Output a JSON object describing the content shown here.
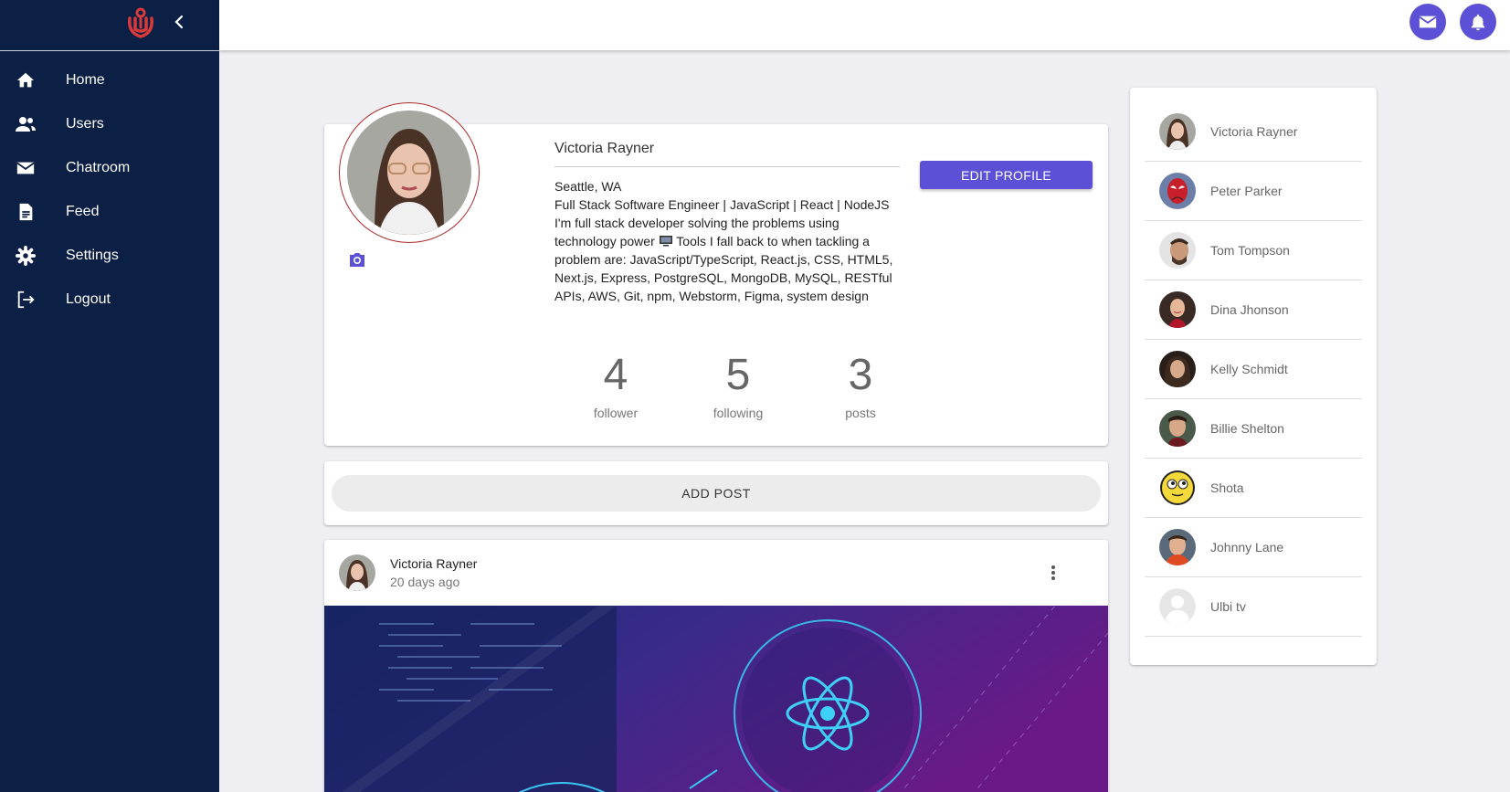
{
  "sidebar": {
    "logo": "ulbi-logo",
    "collapse_icon": "chevron-left-icon",
    "items": [
      {
        "label": "Home",
        "icon": "home-icon"
      },
      {
        "label": "Users",
        "icon": "users-icon"
      },
      {
        "label": "Chatroom",
        "icon": "mail-icon"
      },
      {
        "label": "Feed",
        "icon": "document-icon"
      },
      {
        "label": "Settings",
        "icon": "gear-icon"
      },
      {
        "label": "Logout",
        "icon": "logout-icon"
      }
    ]
  },
  "topbar": {
    "icons": [
      "mail-icon",
      "bell-icon"
    ]
  },
  "profile": {
    "name": "Victoria Rayner",
    "location": "Seattle, WA",
    "headline": "Full Stack Software Engineer | JavaScript | React | NodeJS",
    "bio_before": "I'm full stack developer solving the problems using technology power",
    "bio_after": "Tools I fall back to when tackling a problem are: JavaScript/TypeScript, React.js, CSS, HTML5, Next.js, Express, PostgreSQL, MongoDB, MySQL, RESTful APIs, AWS, Git, npm, Webstorm, Figma, system design",
    "edit_label": "EDIT PROFILE",
    "stats": [
      {
        "value": "4",
        "label": "follower"
      },
      {
        "value": "5",
        "label": "following"
      },
      {
        "value": "3",
        "label": "posts"
      }
    ]
  },
  "add_post": {
    "label": "ADD POST"
  },
  "post": {
    "author": "Victoria Rayner",
    "time": "20 days ago"
  },
  "friends": [
    {
      "name": "Victoria Rayner"
    },
    {
      "name": "Peter Parker"
    },
    {
      "name": "Tom Tompson"
    },
    {
      "name": "Dina Jhonson"
    },
    {
      "name": "Kelly Schmidt"
    },
    {
      "name": "Billie Shelton"
    },
    {
      "name": "Shota"
    },
    {
      "name": "Johnny Lane"
    },
    {
      "name": "Ulbi tv"
    }
  ],
  "colors": {
    "sidebar_bg": "#0c1f45",
    "accent": "#5b50d6",
    "logo_red": "#d63a3a",
    "background": "#eeeef3"
  }
}
